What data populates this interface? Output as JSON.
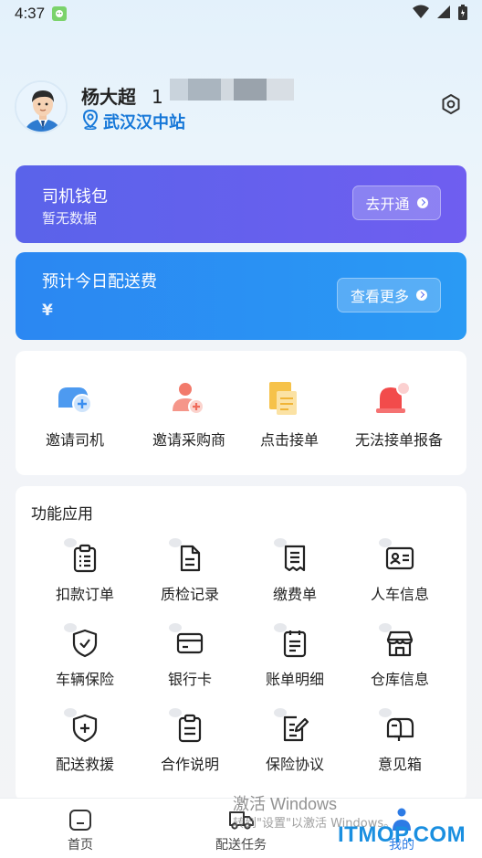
{
  "status_bar": {
    "time": "4:37"
  },
  "profile": {
    "name": "杨大超",
    "phone_prefix": "1",
    "station": "武汉汉中站"
  },
  "wallet": {
    "title": "司机钱包",
    "subtitle": "暂无数据",
    "button": "去开通"
  },
  "delivery_fee": {
    "title": "预计今日配送费",
    "amount": "¥",
    "button": "查看更多"
  },
  "quick_actions": [
    {
      "label": "邀请司机",
      "icon": "invite-driver-icon"
    },
    {
      "label": "邀请采购商",
      "icon": "invite-buyer-icon"
    },
    {
      "label": "点击接单",
      "icon": "accept-order-icon"
    },
    {
      "label": "无法接单报备",
      "icon": "alarm-bell-icon"
    }
  ],
  "functions": {
    "title": "功能应用",
    "items": [
      {
        "label": "扣款订单",
        "icon": "clipboard-list-icon"
      },
      {
        "label": "质检记录",
        "icon": "document-icon"
      },
      {
        "label": "缴费单",
        "icon": "receipt-icon"
      },
      {
        "label": "人车信息",
        "icon": "id-card-icon"
      },
      {
        "label": "车辆保险",
        "icon": "shield-check-icon"
      },
      {
        "label": "银行卡",
        "icon": "credit-card-icon"
      },
      {
        "label": "账单明细",
        "icon": "bill-icon"
      },
      {
        "label": "仓库信息",
        "icon": "warehouse-icon"
      },
      {
        "label": "配送救援",
        "icon": "shield-plus-icon"
      },
      {
        "label": "合作说明",
        "icon": "clipboard-icon"
      },
      {
        "label": "保险协议",
        "icon": "edit-document-icon"
      },
      {
        "label": "意见箱",
        "icon": "mailbox-icon"
      }
    ]
  },
  "bottom_nav": [
    {
      "label": "首页",
      "icon": "home-icon"
    },
    {
      "label": "配送任务",
      "icon": "truck-icon"
    },
    {
      "label": "我的",
      "icon": "user-icon"
    }
  ],
  "watermark": {
    "line1": "激活 Windows",
    "line2": "转到\"设置\"以激活 Windows。",
    "logo": "ITMOP.COM"
  },
  "colors": {
    "wallet_card": "#5a63ea",
    "fee_card": "#2b87f2",
    "accent": "#1577d8",
    "nav_active": "#2d7be5"
  }
}
